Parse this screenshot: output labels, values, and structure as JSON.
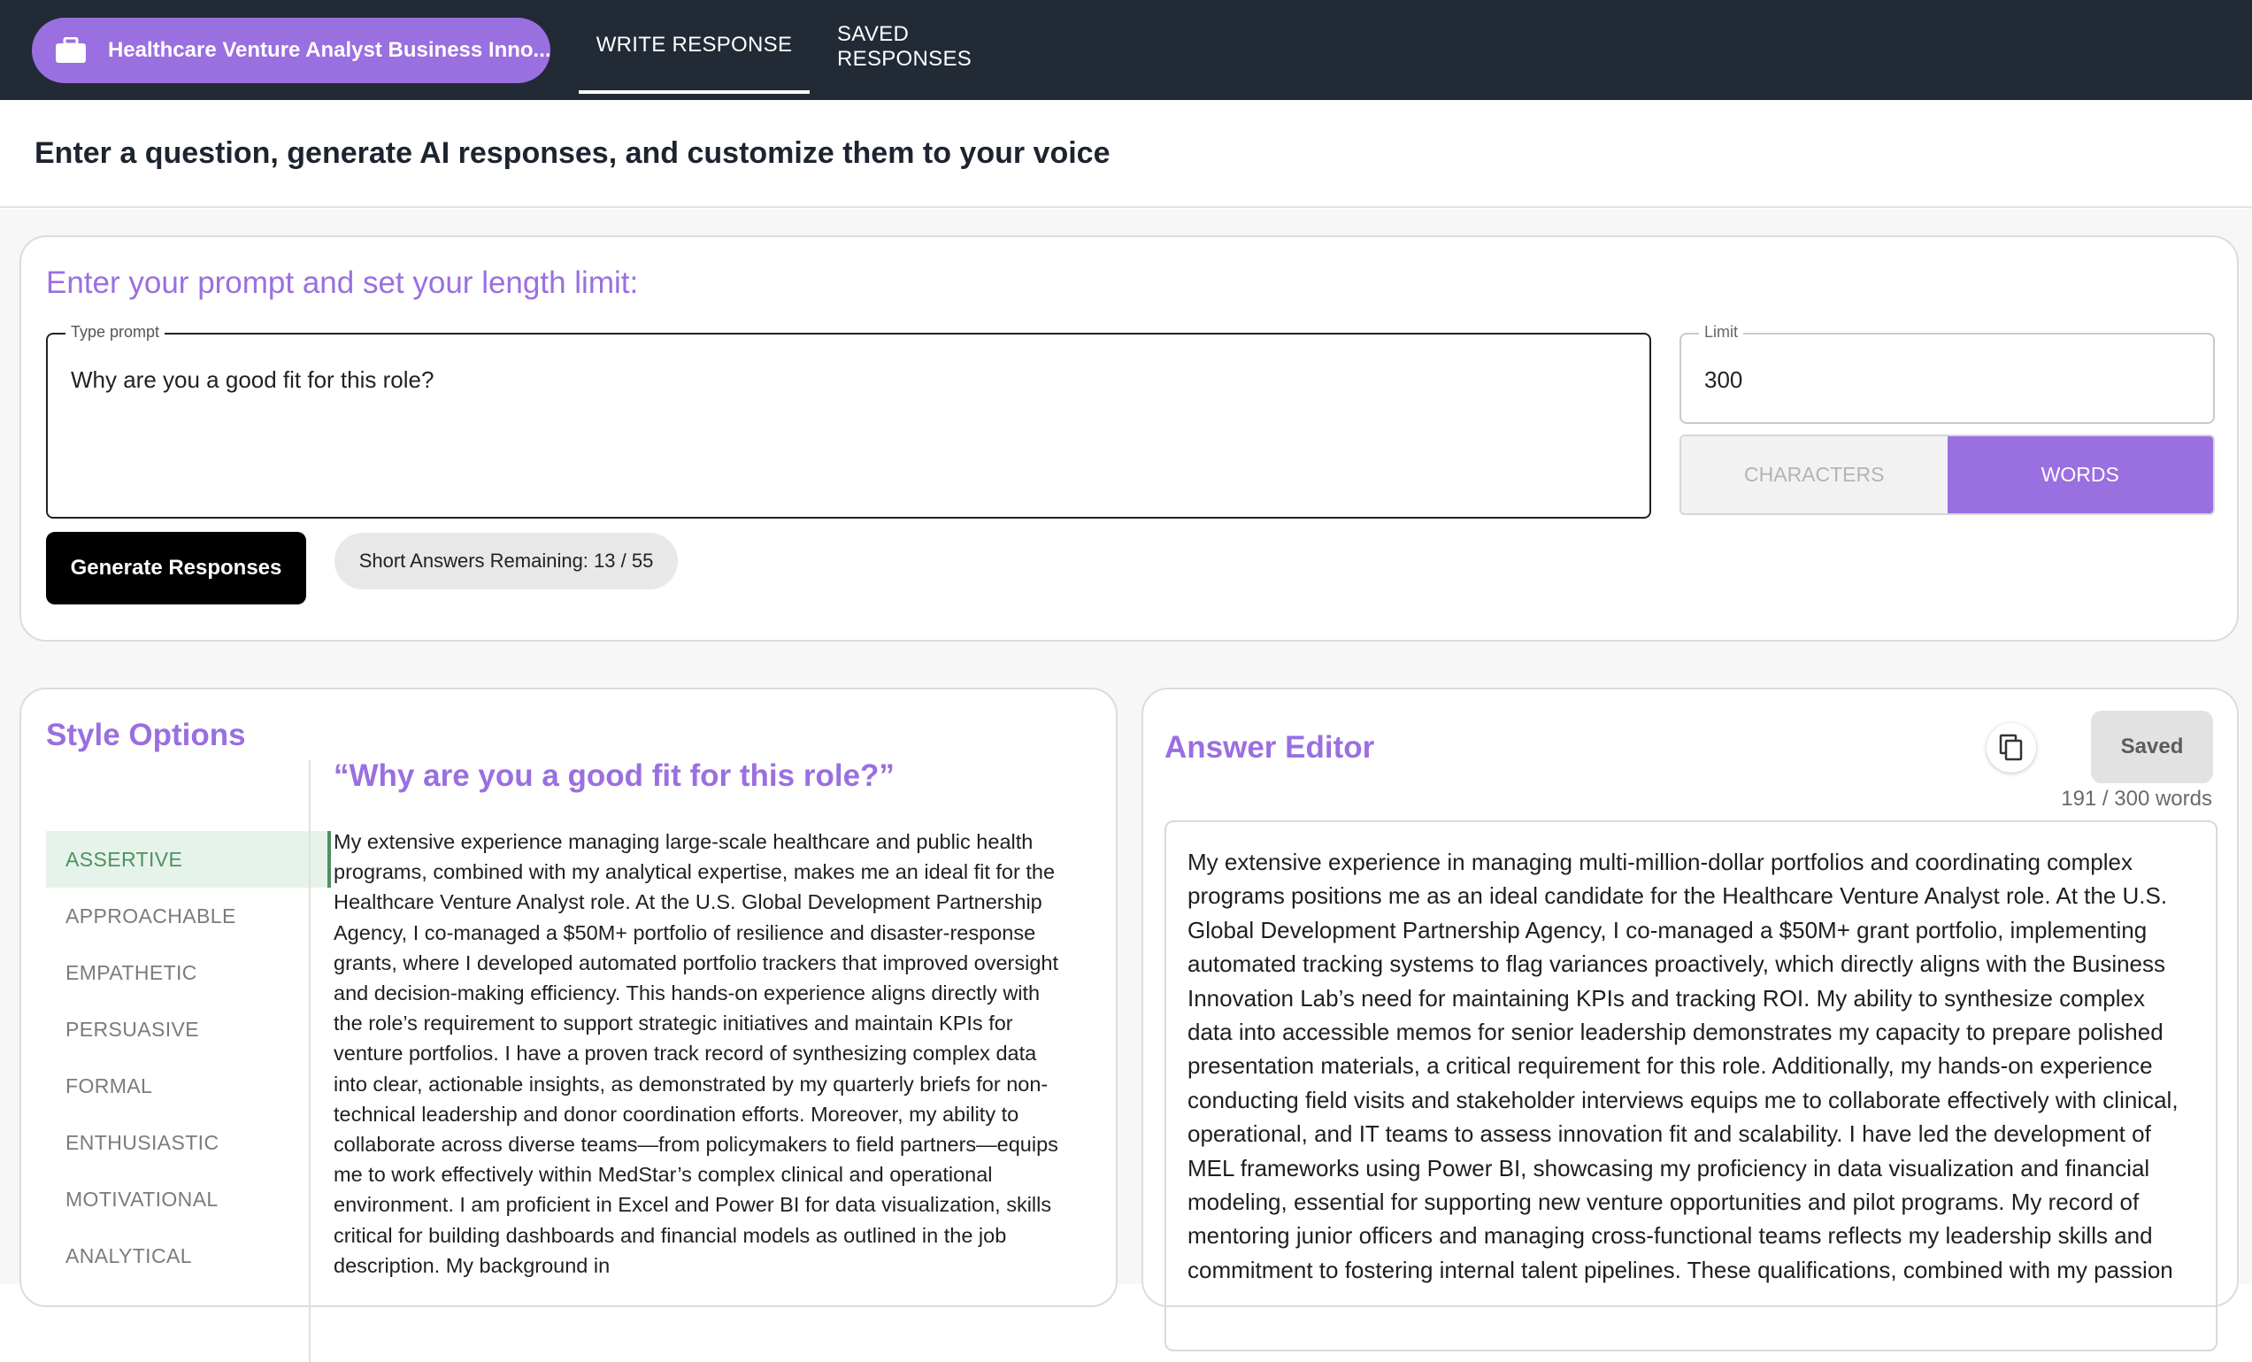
{
  "nav": {
    "job_title": "Healthcare Venture Analyst Business Inno...",
    "tabs": [
      {
        "label": "WRITE RESPONSE"
      },
      {
        "label": "SAVED RESPONSES"
      }
    ]
  },
  "header": {
    "title": "Enter a question, generate AI responses, and customize them to your voice"
  },
  "prompt_card": {
    "title": "Enter your prompt and set your length limit:",
    "prompt_legend": "Type prompt",
    "prompt_value": "Why are you a good fit for this role?",
    "limit_legend": "Limit",
    "limit_value": "300",
    "unit_options": [
      "CHARACTERS",
      "WORDS"
    ],
    "generate_label": "Generate Responses",
    "remaining": "Short Answers Remaining: 13 / 55"
  },
  "style_options": {
    "title": "Style Options",
    "items": [
      {
        "label": "ASSERTIVE"
      },
      {
        "label": "APPROACHABLE"
      },
      {
        "label": "EMPATHETIC"
      },
      {
        "label": "PERSUASIVE"
      },
      {
        "label": "FORMAL"
      },
      {
        "label": "ENTHUSIASTIC"
      },
      {
        "label": "MOTIVATIONAL"
      },
      {
        "label": "ANALYTICAL"
      }
    ],
    "question": "“Why are you a good fit for this role?”",
    "response": "My extensive experience managing large-scale healthcare and public health programs, combined with my analytical expertise, makes me an ideal fit for the Healthcare Venture Analyst role. At the U.S. Global Development Partnership Agency, I co-managed a $50M+ portfolio of resilience and disaster-response grants, where I developed automated portfolio trackers that improved oversight and decision-making efficiency. This hands-on experience aligns directly with the role’s requirement to support strategic initiatives and maintain KPIs for venture portfolios. I have a proven track record of synthesizing complex data into clear, actionable insights, as demonstrated by my quarterly briefs for non-technical leadership and donor coordination efforts. Moreover, my ability to collaborate across diverse teams—from policymakers to field partners—equips me to work effectively within MedStar’s complex clinical and operational environment. I am proficient in Excel and Power BI for data visualization, skills critical for building dashboards and financial models as outlined in the job description. My background in"
  },
  "answer_editor": {
    "title": "Answer Editor",
    "saved_label": "Saved",
    "word_count": "191 / 300 words",
    "text": "My extensive experience in managing multi-million-dollar portfolios and coordinating complex programs positions me as an ideal candidate for the Healthcare Venture Analyst role. At the U.S. Global Development Partnership Agency, I co-managed a $50M+ grant portfolio, implementing automated tracking systems to flag variances proactively, which directly aligns with the Business Innovation Lab’s need for maintaining KPIs and tracking ROI. My ability to synthesize complex data into accessible memos for senior leadership demonstrates my capacity to prepare polished presentation materials, a critical requirement for this role. Additionally, my hands-on experience conducting field visits and stakeholder interviews equips me to collaborate effectively with clinical, operational, and IT teams to assess innovation fit and scalability. I have led the development of MEL frameworks using Power BI, showcasing my proficiency in data visualization and financial modeling, essential for supporting new venture opportunities and pilot programs. My record of mentoring junior officers and managing cross-functional teams reflects my leadership skills and commitment to fostering internal talent pipelines. These qualifications, combined with my passion"
  },
  "icons": {
    "job": "briefcase-icon",
    "copy": "copy-icon"
  },
  "colors": {
    "nav_bg": "#222a35",
    "accent": "#9a6fe0",
    "active_style": "#4d9161"
  }
}
